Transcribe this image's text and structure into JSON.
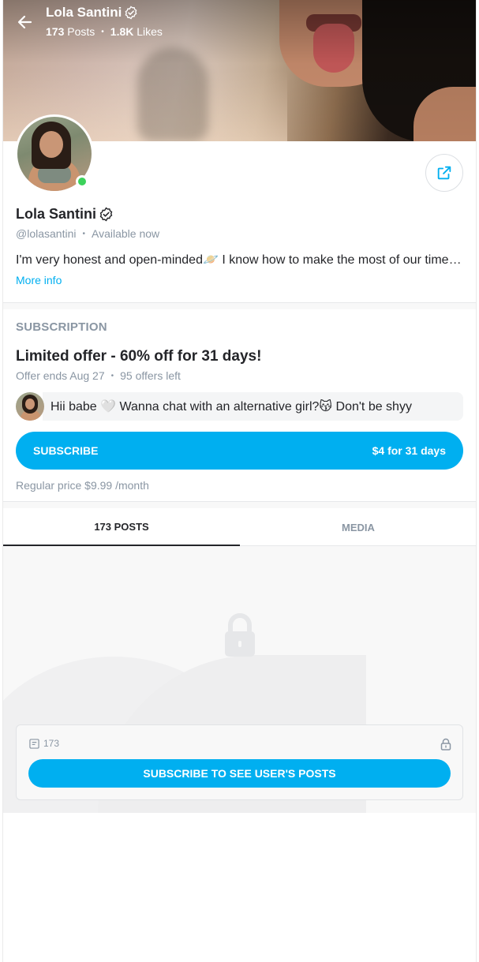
{
  "header": {
    "name": "Lola Santini",
    "posts_count": "173",
    "posts_label": "Posts",
    "likes_count": "1.8K",
    "likes_label": "Likes"
  },
  "profile": {
    "name": "Lola Santini",
    "handle": "@lolasantini",
    "status": "Available now",
    "bio": "I'm very honest and open-minded🪐 I know how to make the most of our time…",
    "more_info": "More info"
  },
  "subscription": {
    "section_label": "SUBSCRIPTION",
    "offer_title": "Limited offer - 60% off for 31 days!",
    "offer_ends": "Offer ends Aug 27",
    "offers_left": "95 offers left",
    "message": "Hii babe 🤍 Wanna chat with an alternative girl?😽 Don't be shyy",
    "button_label": "SUBSCRIBE",
    "button_price": "$4 for 31 days",
    "regular_price": "Regular price $9.99 /month"
  },
  "tabs": [
    {
      "label": "173 POSTS",
      "active": true
    },
    {
      "label": "MEDIA",
      "active": false
    }
  ],
  "locked": {
    "count": "173",
    "button_label": "SUBSCRIBE TO SEE USER'S POSTS"
  },
  "colors": {
    "accent": "#00aff0",
    "online": "#3cd25b",
    "muted": "#8a96a3",
    "text": "#242529"
  },
  "icons": [
    "back-arrow-icon",
    "verified-icon",
    "share-icon",
    "lock-icon",
    "posts-icon"
  ]
}
